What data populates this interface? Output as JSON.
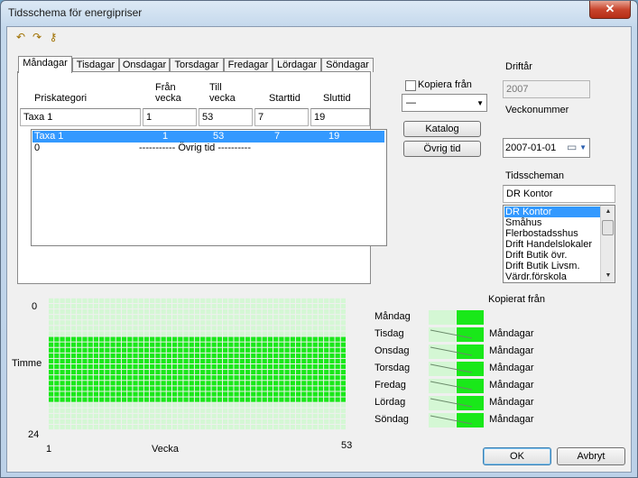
{
  "window": {
    "title": "Tidsschema för energipriser",
    "close_label": "✕"
  },
  "toolbar": {
    "icons": [
      "undo-icon",
      "redo-icon",
      "key-icon"
    ]
  },
  "tabs": [
    "Måndagar",
    "Tisdagar",
    "Onsdagar",
    "Torsdagar",
    "Fredagar",
    "Lördagar",
    "Söndagar"
  ],
  "active_tab": "Måndagar",
  "columns": {
    "priskategori": "Priskategori",
    "fran_vecka": "Från\nvecka",
    "till_vecka": "Till\nvecka",
    "starttid": "Starttid",
    "sluttid": "Sluttid"
  },
  "fields": {
    "priskategori": "Taxa 1",
    "fran_vecka": "1",
    "till_vecka": "53",
    "starttid": "7",
    "sluttid": "19"
  },
  "list": {
    "selected_row": {
      "kategori": "Taxa 1",
      "fran": "1",
      "till": "53",
      "start": "7",
      "slut": "19"
    },
    "second_row": {
      "kategori": "0",
      "text": "----------- Övrig tid ----------"
    }
  },
  "kopiera": {
    "label": "Kopiera från",
    "value": "—"
  },
  "buttons": {
    "katalog": "Katalog",
    "ovrig_tid": "Övrig tid",
    "ok": "OK",
    "avbryt": "Avbryt"
  },
  "right": {
    "driftar_label": "Driftår",
    "driftar_value": "2007",
    "veckonummer_label": "Veckonummer",
    "date_value": "2007-01-01",
    "tidsscheman_label": "Tidsscheman",
    "tidsscheman_value": "DR Kontor",
    "tidsscheman_items": [
      "DR Kontor",
      "Småhus",
      "Flerbostadsshus",
      "Drift Handelslokaler",
      "Drift Butik övr.",
      "Drift Butik Livsm.",
      "Värdr.förskola"
    ]
  },
  "grid": {
    "timme_label": "Timme",
    "vecka_label": "Vecka",
    "y_top": "0",
    "y_bottom": "24",
    "x_left": "1",
    "x_right": "53",
    "weeks": 53,
    "hours": 24,
    "active_start_hour": 7,
    "active_end_hour": 19,
    "colors": {
      "active": "#19e819",
      "inactive": "#d4f7d4"
    }
  },
  "copied": {
    "header": "Kopierat från",
    "days": [
      {
        "day": "Måndag",
        "from": ""
      },
      {
        "day": "Tisdag",
        "from": "Måndagar"
      },
      {
        "day": "Onsdag",
        "from": "Måndagar"
      },
      {
        "day": "Torsdag",
        "from": "Måndagar"
      },
      {
        "day": "Fredag",
        "from": "Måndagar"
      },
      {
        "day": "Lördag",
        "from": "Måndagar"
      },
      {
        "day": "Söndag",
        "from": "Måndagar"
      }
    ]
  }
}
